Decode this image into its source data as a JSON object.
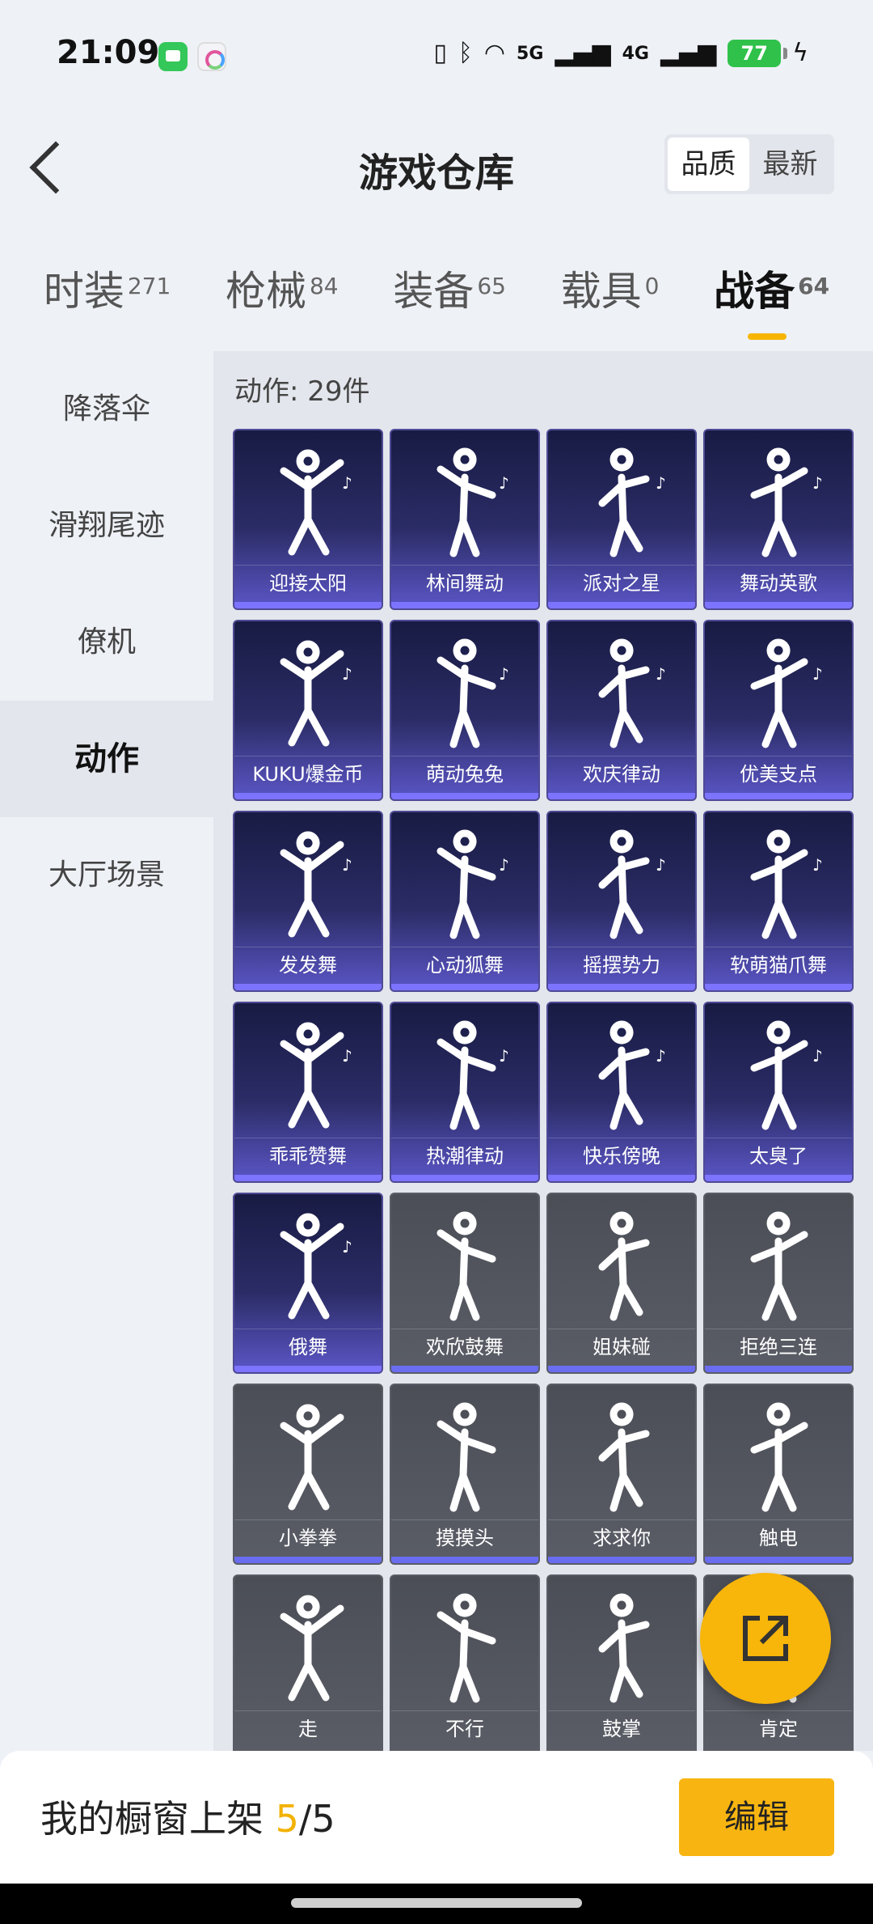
{
  "status_bar": {
    "time": "21:09",
    "battery": "77",
    "signal_labels": [
      "5G",
      "4G"
    ]
  },
  "header": {
    "title": "游戏仓库",
    "sort_options": [
      "品质",
      "最新"
    ],
    "active_sort": "品质"
  },
  "tabs": [
    {
      "label": "时装",
      "count": "271"
    },
    {
      "label": "枪械",
      "count": "84"
    },
    {
      "label": "装备",
      "count": "65"
    },
    {
      "label": "载具",
      "count": "0"
    },
    {
      "label": "战备",
      "count": "64"
    }
  ],
  "active_tab": "战备",
  "sidebar": {
    "items": [
      {
        "label": "降落伞"
      },
      {
        "label": "滑翔尾迹"
      },
      {
        "label": "僚机"
      },
      {
        "label": "动作"
      },
      {
        "label": "大厅场景"
      }
    ],
    "active": "动作"
  },
  "content": {
    "count_label": "动作: 29件",
    "items": [
      {
        "label": "迎接太阳",
        "locked": false
      },
      {
        "label": "林间舞动",
        "locked": false
      },
      {
        "label": "派对之星",
        "locked": false
      },
      {
        "label": "舞动英歌",
        "locked": false
      },
      {
        "label": "KUKU爆金币",
        "locked": false
      },
      {
        "label": "萌动兔兔",
        "locked": false
      },
      {
        "label": "欢庆律动",
        "locked": false
      },
      {
        "label": "优美支点",
        "locked": false
      },
      {
        "label": "发发舞",
        "locked": false
      },
      {
        "label": "心动狐舞",
        "locked": false
      },
      {
        "label": "摇摆势力",
        "locked": false
      },
      {
        "label": "软萌猫爪舞",
        "locked": false
      },
      {
        "label": "乖乖赞舞",
        "locked": false
      },
      {
        "label": "热潮律动",
        "locked": false
      },
      {
        "label": "快乐傍晚",
        "locked": false
      },
      {
        "label": "太臭了",
        "locked": false
      },
      {
        "label": "俄舞",
        "locked": false
      },
      {
        "label": "欢欣鼓舞",
        "locked": true
      },
      {
        "label": "姐妹碰",
        "locked": true
      },
      {
        "label": "拒绝三连",
        "locked": true
      },
      {
        "label": "小拳拳",
        "locked": true
      },
      {
        "label": "摸摸头",
        "locked": true
      },
      {
        "label": "求求你",
        "locked": true
      },
      {
        "label": "触电",
        "locked": true
      },
      {
        "label": "走",
        "locked": true
      },
      {
        "label": "不行",
        "locked": true
      },
      {
        "label": "鼓掌",
        "locked": true
      },
      {
        "label": "肯定",
        "locked": true
      }
    ]
  },
  "bottom": {
    "shelf_prefix": "我的橱窗上架 ",
    "shelf_current": "5",
    "shelf_sep": "/",
    "shelf_total": "5",
    "edit_label": "编辑"
  },
  "colors": {
    "accent": "#f8b512",
    "card_owned": "#2b2c66",
    "card_locked": "#55585f"
  }
}
